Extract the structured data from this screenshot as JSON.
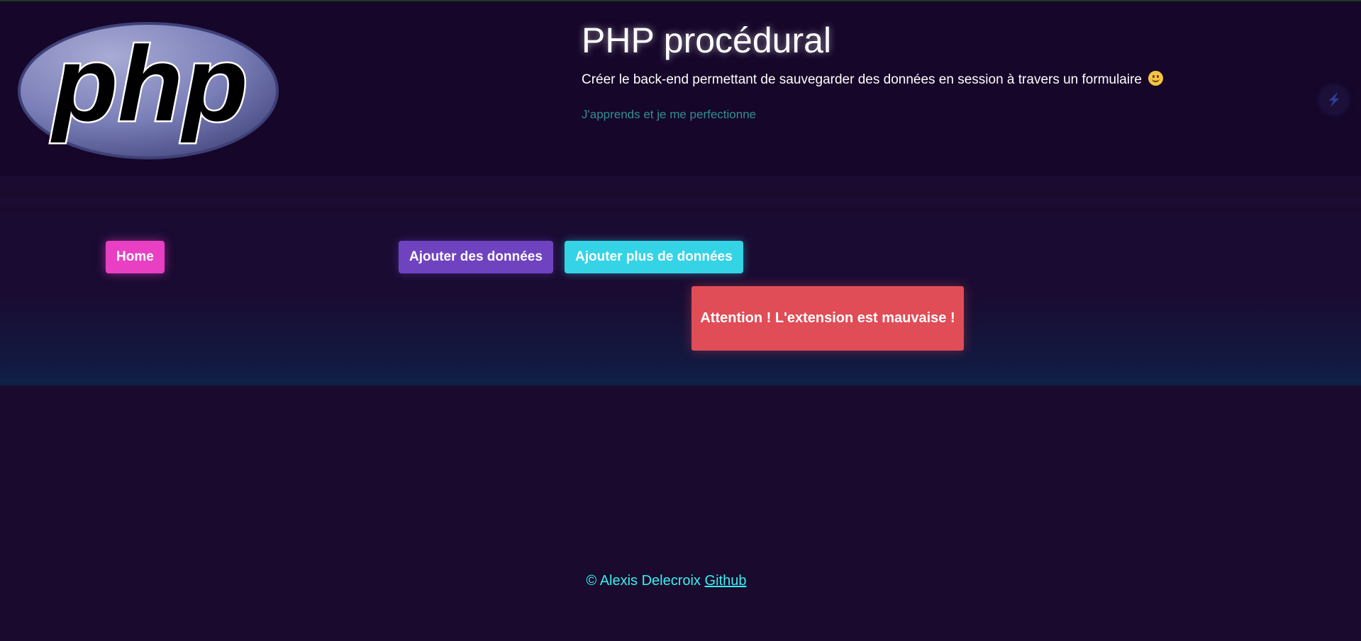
{
  "header": {
    "logo_text": "php",
    "title": "PHP procédural",
    "subtitle": "Créer le back-end permettant de sauvegarder des données en session à travers un formulaire",
    "tagline": "J'apprends et je me perfectionne"
  },
  "nav": {
    "home_label": "Home",
    "add_label": "Ajouter des données",
    "add_more_label": "Ajouter plus de données"
  },
  "alert": {
    "message": "Attention ! L'extension est mauvaise !"
  },
  "footer": {
    "credit": "© Alexis Delecroix",
    "link_label": "Github"
  },
  "colors": {
    "background": "#1a0b2e",
    "home_button": "#e83fc3",
    "add_button": "#6f43c0",
    "add_more_button": "#35d3e6",
    "alert": "#e04d57",
    "footer_text": "#38f0f0",
    "tagline": "#2f8f91"
  },
  "icons": {
    "logo": "php-logo",
    "subtitle_emoji": "slightly-smiling-face-icon",
    "side_button": "lightning-icon"
  }
}
